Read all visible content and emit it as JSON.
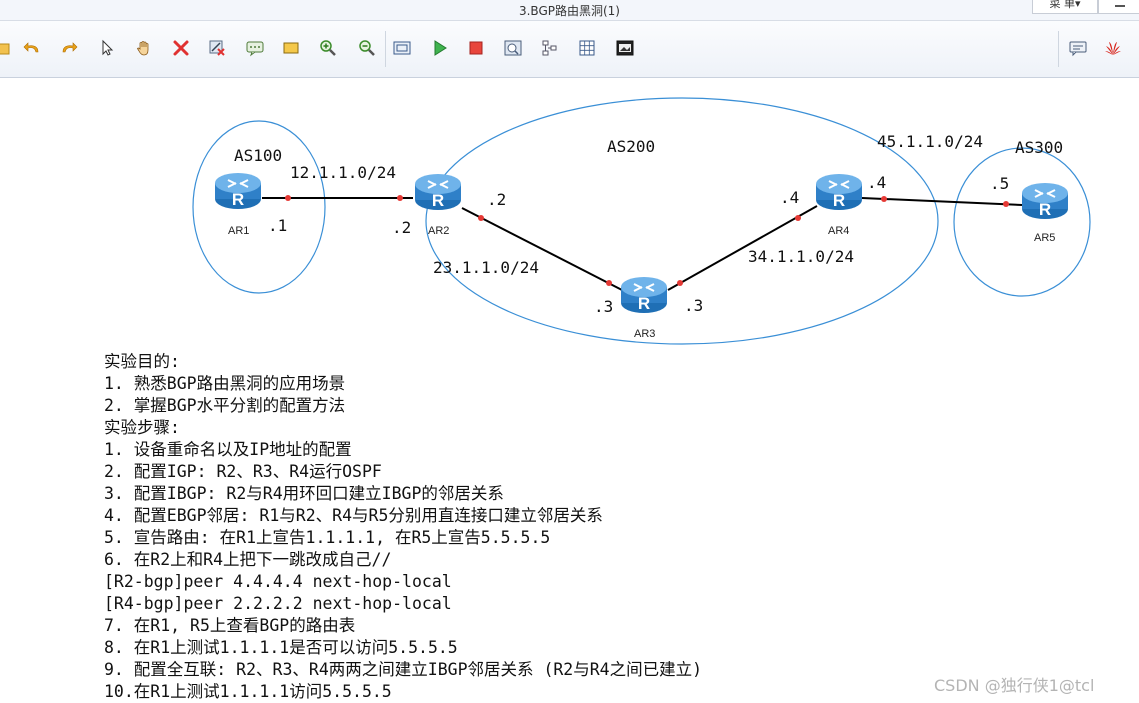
{
  "window": {
    "title": "3.BGP路由黑洞(1)",
    "menu_label": "菜 单▾"
  },
  "toolbar": {
    "tools": [
      {
        "name": "open-icon"
      },
      {
        "name": "undo-icon"
      },
      {
        "name": "redo-icon"
      },
      {
        "name": "select-icon"
      },
      {
        "name": "pan-icon"
      },
      {
        "name": "delete-icon"
      },
      {
        "name": "delete-link-icon"
      },
      {
        "name": "text-icon"
      },
      {
        "name": "rectangle-icon"
      },
      {
        "name": "zoom-in-icon"
      },
      {
        "name": "zoom-out-icon"
      },
      {
        "name": "fit-icon"
      },
      {
        "name": "start-icon"
      },
      {
        "name": "stop-icon"
      },
      {
        "name": "capture-icon"
      },
      {
        "name": "topology-icon"
      },
      {
        "name": "grid-icon"
      },
      {
        "name": "screenshot-icon"
      },
      {
        "name": "chat-icon"
      },
      {
        "name": "huawei-logo-icon"
      }
    ]
  },
  "topology": {
    "as_labels": {
      "as100": "AS100",
      "as200": "AS200",
      "as300": "AS300"
    },
    "networks": {
      "n12": "12.1.1.0/24",
      "n23": "23.1.1.0/24",
      "n34": "34.1.1.0/24",
      "n45": "45.1.1.0/24"
    },
    "routers": {
      "ar1": "AR1",
      "ar2": "AR2",
      "ar3": "AR3",
      "ar4": "AR4",
      "ar5": "AR5"
    },
    "interfaces": {
      "ar1_e": ".1",
      "ar2_w": ".2",
      "ar2_e": ".2",
      "ar3_w": ".3",
      "ar3_e": ".3",
      "ar4_w": ".4",
      "ar4_e": ".4",
      "ar5_w": ".5"
    },
    "colors": {
      "link": "#000000",
      "endpoint": "#e53935",
      "area": "#3a8fd6",
      "router": "#2f80c8"
    }
  },
  "notes": [
    "实验目的:",
    "1. 熟悉BGP路由黑洞的应用场景",
    "2. 掌握BGP水平分割的配置方法",
    "实验步骤:",
    "1. 设备重命名以及IP地址的配置",
    "2. 配置IGP: R2、R3、R4运行OSPF",
    "3. 配置IBGP: R2与R4用环回口建立IBGP的邻居关系",
    "4. 配置EBGP邻居: R1与R2、R4与R5分别用直连接口建立邻居关系",
    "5. 宣告路由: 在R1上宣告1.1.1.1, 在R5上宣告5.5.5.5",
    "6. 在R2上和R4上把下一跳改成自己//",
    "[R2-bgp]peer 4.4.4.4 next-hop-local",
    "[R4-bgp]peer 2.2.2.2 next-hop-local",
    "7. 在R1, R5上查看BGP的路由表",
    "8. 在R1上测试1.1.1.1是否可以访问5.5.5.5",
    "9. 配置全互联: R2、R3、R4两两之间建立IBGP邻居关系 (R2与R4之间已建立)",
    "10.在R1上测试1.1.1.1访问5.5.5.5"
  ],
  "watermark": "CSDN @独行侠1@tcl"
}
